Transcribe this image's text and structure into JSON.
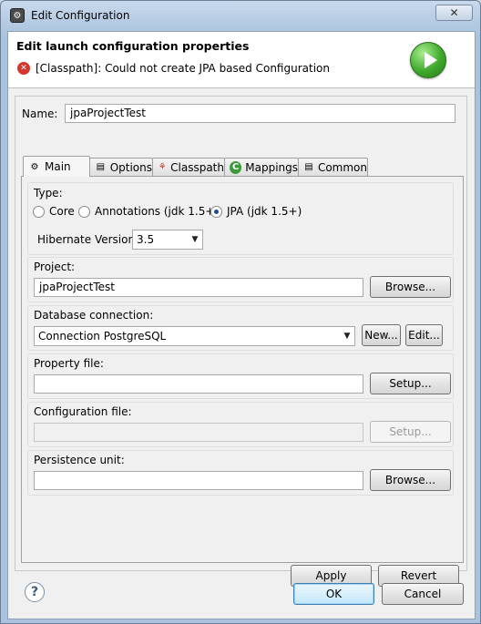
{
  "window": {
    "title": "Edit Configuration",
    "close_glyph": "✕"
  },
  "header": {
    "title": "Edit launch configuration properties",
    "error_message": "[Classpath]: Could not create JPA based Configuration",
    "error_icon": "error-icon",
    "banner_icon": "run-icon"
  },
  "name_field": {
    "label": "Name:",
    "value": "jpaProjectTest"
  },
  "tabs": [
    {
      "label": "Main",
      "icon": "main-tab-icon",
      "active": true
    },
    {
      "label": "Options",
      "icon": "options-tab-icon",
      "active": false
    },
    {
      "label": "Classpath",
      "icon": "classpath-tab-icon",
      "active": false
    },
    {
      "label": "Mappings",
      "icon": "mappings-tab-icon",
      "active": false
    },
    {
      "label": "Common",
      "icon": "common-tab-icon",
      "active": false
    }
  ],
  "type_group": {
    "label": "Type:",
    "options": [
      {
        "label": "Core",
        "selected": false
      },
      {
        "label": "Annotations (jdk 1.5+)",
        "selected": false
      },
      {
        "label": "JPA (jdk 1.5+)",
        "selected": true
      }
    ],
    "hibernate_version_label": "Hibernate Version:",
    "hibernate_version_value": "3.5"
  },
  "project_group": {
    "label": "Project:",
    "value": "jpaProjectTest",
    "button": "Browse..."
  },
  "database_group": {
    "label": "Database connection:",
    "value": "Connection PostgreSQL",
    "new_button": "New...",
    "edit_button": "Edit..."
  },
  "property_group": {
    "label": "Property file:",
    "value": "",
    "button": "Setup..."
  },
  "configuration_group": {
    "label": "Configuration file:",
    "value": "",
    "button": "Setup..."
  },
  "persistence_group": {
    "label": "Persistence unit:",
    "value": "",
    "button": "Browse..."
  },
  "footer": {
    "apply": "Apply",
    "revert": "Revert",
    "ok": "OK",
    "cancel": "Cancel",
    "help_glyph": "?"
  }
}
